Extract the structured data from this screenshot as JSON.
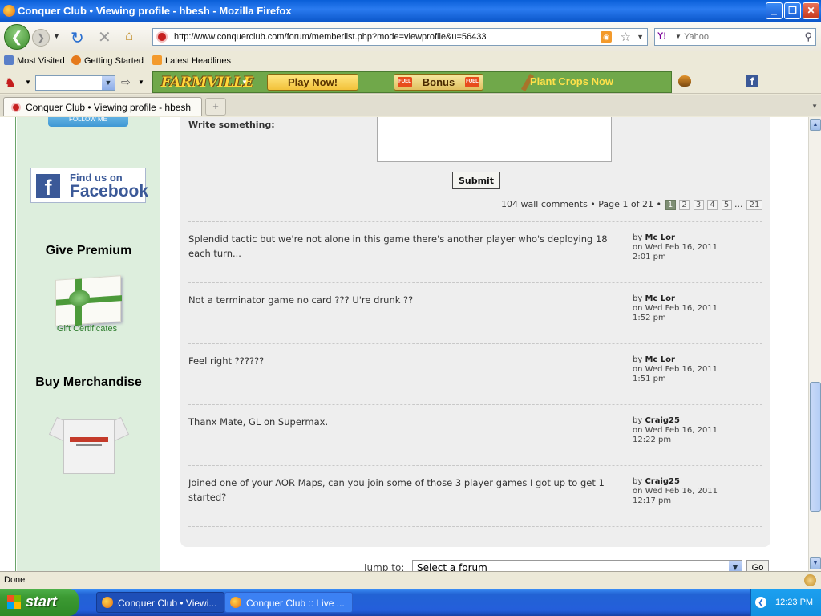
{
  "window": {
    "title": "Conquer Club • Viewing profile - hbesh - Mozilla Firefox",
    "controls": {
      "minimize": "_",
      "maximize": "❐",
      "close": "✕"
    }
  },
  "nav": {
    "url": "http://www.conquerclub.com/forum/memberlist.php?mode=viewprofile&u=56433",
    "search_placeholder": "Yahoo",
    "search_engine": "Y!"
  },
  "bookmarks": [
    "Most Visited",
    "Getting Started",
    "Latest Headlines"
  ],
  "farmville_toolbar": {
    "logo": "FARMVILLE",
    "play": "Play Now!",
    "bonus": "Bonus",
    "fuel": "FUEL",
    "plant": "Plant Crops Now"
  },
  "tabs": [
    {
      "label": "Conquer Club • Viewing profile - hbesh"
    }
  ],
  "sidebar": {
    "follow": "FOLLOW ME",
    "facebook_find": "Find us on",
    "facebook_name": "Facebook",
    "give_premium": "Give Premium",
    "gift_caption": "Gift Certificates",
    "buy_merch": "Buy Merchandise"
  },
  "wall": {
    "write_label": "Write something:",
    "submit_label": "Submit",
    "summary": "104 wall comments • Page 1 of 21 •",
    "pages": [
      "1",
      "2",
      "3",
      "4",
      "5"
    ],
    "current_page": "1",
    "ellipsis": "...",
    "last_page": "21",
    "comments": [
      {
        "text": "Splendid tactic but we're not alone in this game there's another player who's deploying 18 each turn...",
        "by": "by",
        "user": "Mc Lor",
        "date": "on Wed Feb 16, 2011",
        "time": "2:01 pm"
      },
      {
        "text": "Not a terminator game no card ??? U're drunk ??",
        "by": "by",
        "user": "Mc Lor",
        "date": "on Wed Feb 16, 2011",
        "time": "1:52 pm"
      },
      {
        "text": "Feel right ??????",
        "by": "by",
        "user": "Mc Lor",
        "date": "on Wed Feb 16, 2011",
        "time": "1:51 pm"
      },
      {
        "text": "Thanx Mate, GL on Supermax.",
        "by": "by",
        "user": "Craig25",
        "date": "on Wed Feb 16, 2011",
        "time": "12:22 pm"
      },
      {
        "text": "Joined one of your AOR Maps, can you join some of those 3 player games I got up to get 1 started?",
        "by": "by",
        "user": "Craig25",
        "date": "on Wed Feb 16, 2011",
        "time": "12:17 pm"
      }
    ]
  },
  "jump": {
    "label": "Jump to:",
    "selected": "Select a forum",
    "go": "Go"
  },
  "status": "Done",
  "taskbar": {
    "start": "start",
    "tasks": [
      "Conquer Club • Viewi...",
      "Conquer Club :: Live ..."
    ],
    "clock": "12:23 PM"
  }
}
